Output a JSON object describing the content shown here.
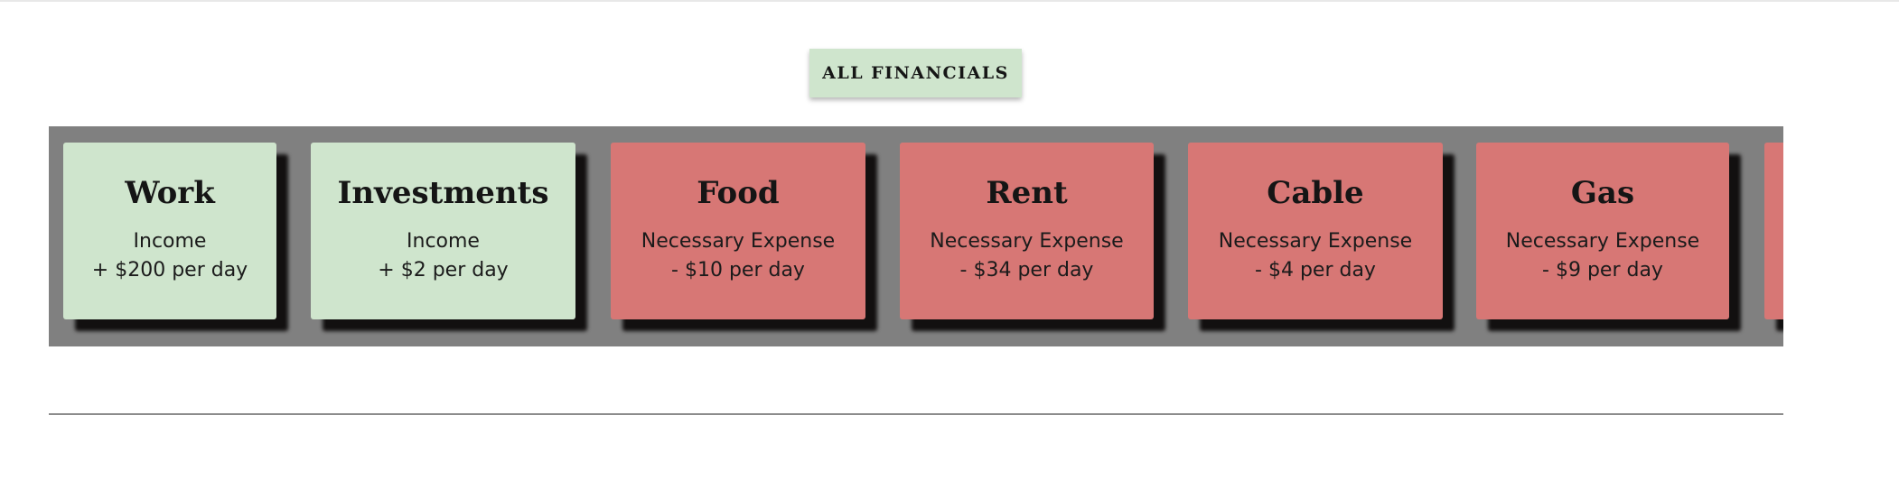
{
  "header": {
    "all_button_label": "ALL FINANCIALS"
  },
  "colors": {
    "income": "#cfe5cd",
    "expense": "#d77775",
    "strip": "#808080"
  },
  "cards": [
    {
      "title": "Work",
      "type": "Income",
      "amount": "+ $200 per day"
    },
    {
      "title": "Investments",
      "type": "Income",
      "amount": "+ $2 per day"
    },
    {
      "title": "Food",
      "type": "Necessary Expense",
      "amount": "- $10 per day"
    },
    {
      "title": "Rent",
      "type": "Necessary Expense",
      "amount": "- $34 per day"
    },
    {
      "title": "Cable",
      "type": "Necessary Expense",
      "amount": "- $4 per day"
    },
    {
      "title": "Gas",
      "type": "Necessary Expense",
      "amount": "- $9 per day"
    }
  ]
}
